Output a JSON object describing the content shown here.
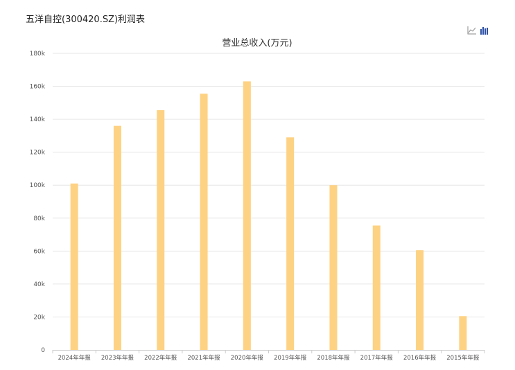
{
  "page": {
    "title": "五洋自控(300420.SZ)利润表"
  },
  "toolbar": {
    "line_icon": "line-chart-icon",
    "bar_icon": "bar-chart-icon"
  },
  "colors": {
    "bar": "#fdd283",
    "grid": "#e6e6e6",
    "axis": "#cccccc",
    "bar_icon_active": "#2b4fa3",
    "line_icon": "#888888"
  },
  "chart_data": {
    "type": "bar",
    "title": "营业总收入(万元)",
    "xlabel": "",
    "ylabel": "",
    "categories": [
      "2024年年报",
      "2023年年报",
      "2022年年报",
      "2021年年报",
      "2020年年报",
      "2019年年报",
      "2018年年报",
      "2017年年报",
      "2016年年报",
      "2015年年报"
    ],
    "values": [
      101000,
      136000,
      145500,
      155500,
      163000,
      129000,
      100000,
      75500,
      60500,
      20500
    ],
    "ylim": [
      0,
      180000
    ],
    "yticks": [
      0,
      20000,
      40000,
      60000,
      80000,
      100000,
      120000,
      140000,
      160000,
      180000
    ],
    "ytick_labels": [
      "0",
      "20k",
      "40k",
      "60k",
      "80k",
      "100k",
      "120k",
      "140k",
      "160k",
      "180k"
    ],
    "grid": true,
    "legend": "none"
  }
}
